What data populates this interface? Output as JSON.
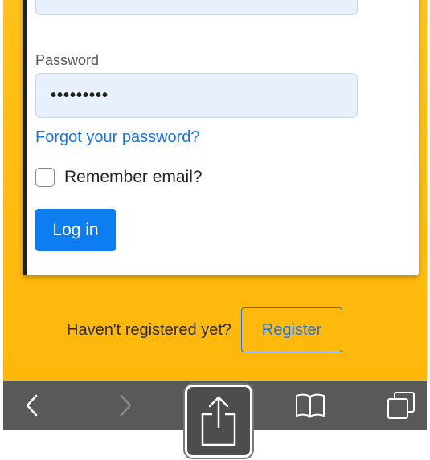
{
  "form": {
    "password_label": "Password",
    "password_value": "•••••••••",
    "forgot_link": "Forgot your password?",
    "remember_label": "Remember email?",
    "remember_checked": false,
    "login_button": "Log in"
  },
  "register": {
    "prompt": "Haven't registered yet?",
    "button": "Register"
  },
  "toolbar": {
    "icons": [
      "chevron-left-icon",
      "chevron-right-icon",
      "share-icon",
      "book-icon",
      "tabs-icon"
    ],
    "highlighted": "share-icon"
  },
  "colors": {
    "background": "#ffbe14",
    "primary": "#0d7ef2",
    "link": "#1a73e8",
    "input_fill": "#e8f0fe",
    "toolbar": "#595959"
  }
}
